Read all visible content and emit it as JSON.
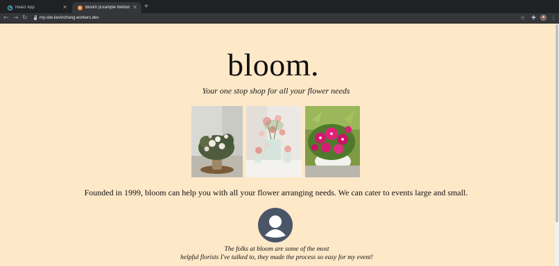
{
  "browser": {
    "tabs": [
      {
        "title": "React App",
        "icon": "react-icon",
        "active": false
      },
      {
        "title": "Bloom (Example Website)",
        "icon": "bloom-favicon-icon",
        "active": true
      }
    ],
    "url": "my-site.kevinzhang.workers.dev"
  },
  "site": {
    "title": "bloom.",
    "tagline": "Your one stop shop for all your flower needs",
    "about": "Founded in 1999, bloom can help you with all your flower arranging needs. We can cater to events large and small.",
    "testimonial": {
      "line1": "The folks at bloom are some of the most",
      "line2": "helpful florists I've talked to, they made the process so easy for my event!"
    },
    "colors": {
      "background": "#fde8c8",
      "avatar": "#4a5568"
    }
  }
}
